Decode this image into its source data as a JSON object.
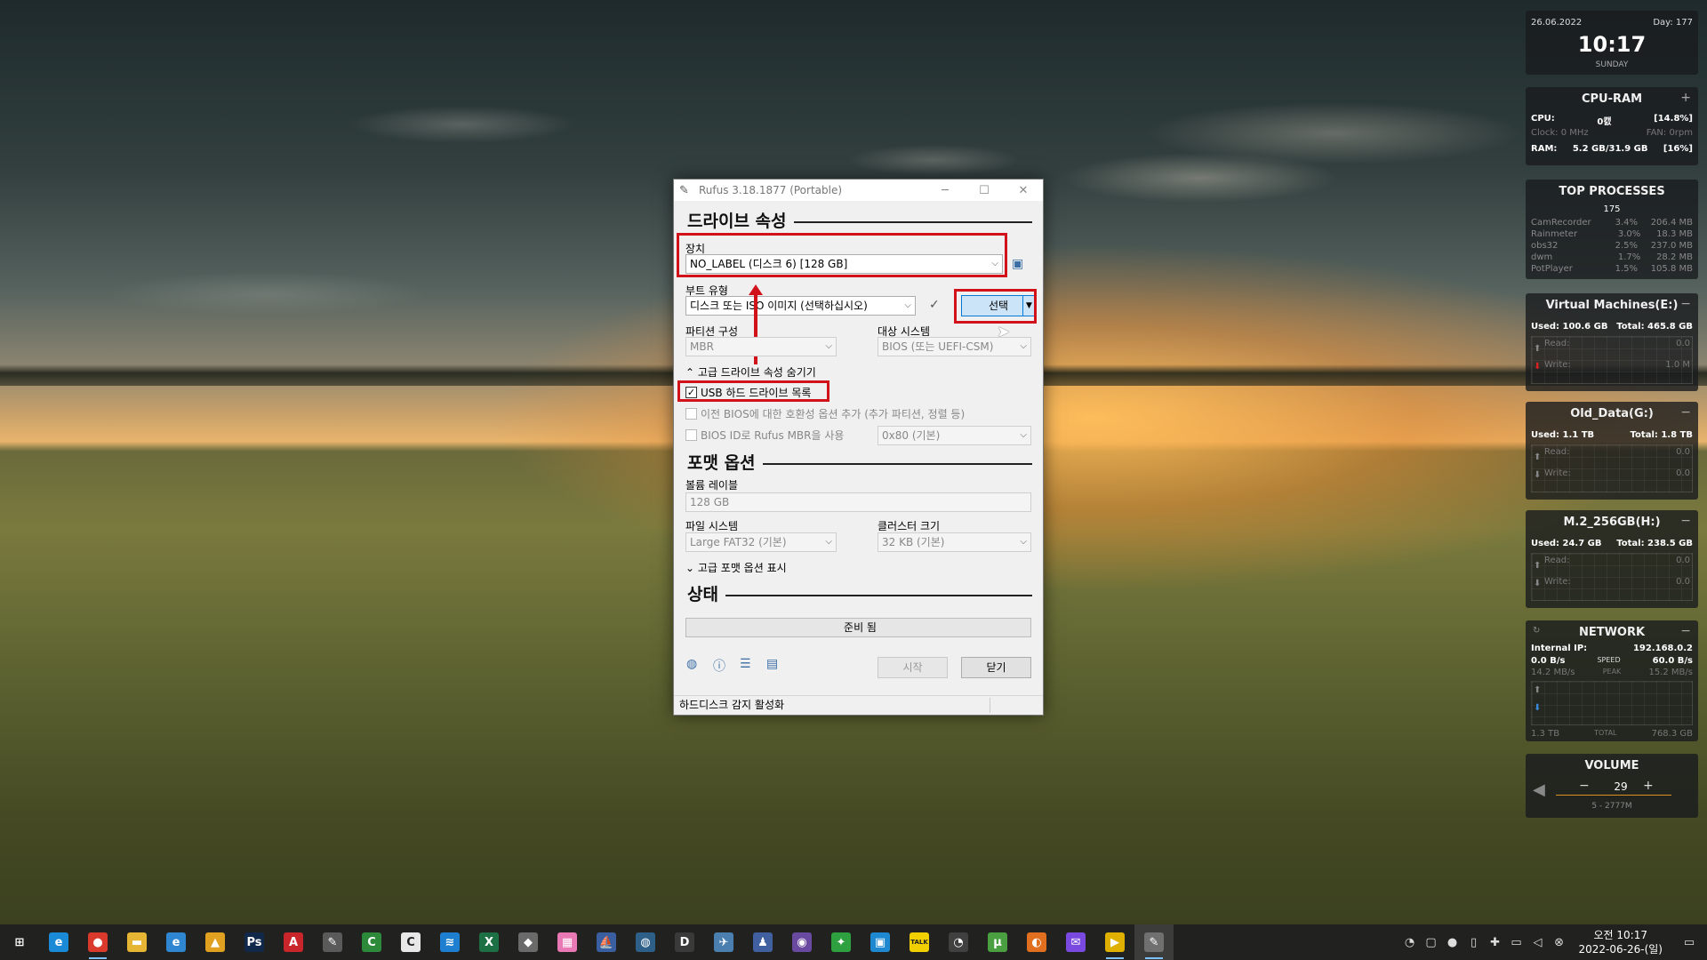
{
  "window": {
    "title": "Rufus 3.18.1877 (Portable)",
    "minimize": "─",
    "maximize": "☐",
    "close": "✕"
  },
  "drive_props": {
    "heading": "드라이브 속성",
    "device_label": "장치",
    "device_value": "NO_LABEL (디스크 6) [128 GB]",
    "boot_type_label": "부트 유형",
    "boot_type_value": "디스크 또는 ISO 이미지 (선택하십시오)",
    "select_button": "선택",
    "partition_label": "파티션 구성",
    "partition_value": "MBR",
    "target_label": "대상 시스템",
    "target_value": "BIOS (또는 UEFI-CSM)",
    "advanced_toggle": "고급 드라이브 속성 숨기기",
    "usb_hdd_label": "USB 하드 드라이브 목록",
    "legacy_bios_label": "이전 BIOS에 대한 호환성 옵션 추가 (추가 파티션, 정렬 등)",
    "rufus_mbr_label": "BIOS ID로 Rufus MBR을 사용",
    "bios_id_value": "0x80 (기본)"
  },
  "format_opts": {
    "heading": "포맷 옵션",
    "volume_label_label": "볼륨 레이블",
    "volume_label_value": "128 GB",
    "filesystem_label": "파일 시스템",
    "filesystem_value": "Large FAT32 (기본)",
    "cluster_label": "클러스터 크기",
    "cluster_value": "32 KB (기본)",
    "advanced_toggle": "고급 포맷 옵션 표시"
  },
  "status": {
    "heading": "상태",
    "progress_text": "준비 됨",
    "start_button": "시작",
    "close_button": "닫기",
    "statusbar_text": "하드디스크 감지 활성화"
  },
  "gadgets": {
    "clock": {
      "date": "26.06.2022",
      "day": "Day: 177",
      "time": "10:17",
      "weekday": "SUNDAY"
    },
    "cpu": {
      "title": "CPU-RAM",
      "cpu_label": "CPU:",
      "cpu_temp": "0캜",
      "cpu_pct": "[14.8%]",
      "clock_label": "Clock: 0 MHz",
      "fan_label": "FAN: 0rpm",
      "ram_label": "RAM:",
      "ram_value": "5.2 GB/31.9 GB",
      "ram_pct": "[16%]"
    },
    "top": {
      "title": "TOP PROCESSES",
      "count": "175",
      "rows": [
        {
          "name": "CamRecorder",
          "cpu": "3.4%",
          "mem": "206.4 MB"
        },
        {
          "name": "Rainmeter",
          "cpu": "3.0%",
          "mem": "18.3 MB"
        },
        {
          "name": "obs32",
          "cpu": "2.5%",
          "mem": "237.0 MB"
        },
        {
          "name": "dwm",
          "cpu": "1.7%",
          "mem": "28.2 MB"
        },
        {
          "name": "PotPlayer",
          "cpu": "1.5%",
          "mem": "105.8 MB"
        }
      ]
    },
    "drives": [
      {
        "title": "Virtual Machines(E:)",
        "used": "Used: 100.6 GB",
        "total": "Total: 465.8 GB",
        "read": "Read:",
        "write": "Write:",
        "rv": "0.0",
        "wv": "1.0 M"
      },
      {
        "title": "Old_Data(G:)",
        "used": "Used: 1.1 TB",
        "total": "Total: 1.8 TB",
        "read": "Read:",
        "write": "Write:",
        "rv": "0.0",
        "wv": "0.0"
      },
      {
        "title": "M.2_256GB(H:)",
        "used": "Used: 24.7 GB",
        "total": "Total: 238.5 GB",
        "read": "Read:",
        "write": "Write:",
        "rv": "0.0",
        "wv": "0.0"
      }
    ],
    "network": {
      "title": "NETWORK",
      "ip_label": "Internal IP:",
      "ip": "192.168.0.2",
      "up": "0.0 B/s",
      "speed_label": "SPEED",
      "speed": "60.0 B/s",
      "down": "14.2 MB/s",
      "peak_label": "PEAK",
      "peak": "15.2 MB/s",
      "total_left": "1.3 TB",
      "total_label": "TOTAL",
      "total_right": "768.3 GB"
    },
    "volume": {
      "title": "VOLUME",
      "minus": "−",
      "value": "29",
      "plus": "+",
      "sub": "5 - 2777M"
    }
  },
  "taskbar": {
    "clock_time": "오전 10:17",
    "clock_date": "2022-06-26-(일)",
    "apps": [
      {
        "name": "start-icon",
        "glyph": "⊞",
        "bg": "transparent"
      },
      {
        "name": "edge-icon",
        "glyph": "e",
        "bg": "#1b8ad6"
      },
      {
        "name": "chrome-icon",
        "glyph": "●",
        "bg": "#d93a2b"
      },
      {
        "name": "file-explorer-icon",
        "glyph": "▬",
        "bg": "#e6b534"
      },
      {
        "name": "ie-icon",
        "glyph": "e",
        "bg": "#2f86d1"
      },
      {
        "name": "app-triangle-icon",
        "glyph": "▲",
        "bg": "#e0a020"
      },
      {
        "name": "photoshop-icon",
        "glyph": "Ps",
        "bg": "#10284a"
      },
      {
        "name": "acrobat-icon",
        "glyph": "A",
        "bg": "#c9262b"
      },
      {
        "name": "app-tool-icon",
        "glyph": "✎",
        "bg": "#5a5a5a"
      },
      {
        "name": "camtasia-icon",
        "glyph": "C",
        "bg": "#2d8a3a"
      },
      {
        "name": "app-c-icon",
        "glyph": "C",
        "bg": "#e8e8e8"
      },
      {
        "name": "app-blue-icon",
        "glyph": "≋",
        "bg": "#1e7fd0"
      },
      {
        "name": "excel-icon",
        "glyph": "X",
        "bg": "#1d7044"
      },
      {
        "name": "app-diamond-icon",
        "glyph": "◆",
        "bg": "#6a6a6a"
      },
      {
        "name": "app-pink-icon",
        "glyph": "▦",
        "bg": "#e879b4"
      },
      {
        "name": "app-ship-icon",
        "glyph": "⛵",
        "bg": "#3a5fa0"
      },
      {
        "name": "globe-icon",
        "glyph": "◍",
        "bg": "#2e5f88"
      },
      {
        "name": "app-d-icon",
        "glyph": "D",
        "bg": "#3a3a3a"
      },
      {
        "name": "app-fish-icon",
        "glyph": "✈",
        "bg": "#4a7fb0"
      },
      {
        "name": "app-user-icon",
        "glyph": "♟",
        "bg": "#4060a0"
      },
      {
        "name": "app-circle-icon",
        "glyph": "◉",
        "bg": "#6a4aa0"
      },
      {
        "name": "app-green-icon",
        "glyph": "✦",
        "bg": "#2fa040"
      },
      {
        "name": "app-frame-icon",
        "glyph": "▣",
        "bg": "#1e88d0"
      },
      {
        "name": "kakaotalk-icon",
        "glyph": "TALK",
        "bg": "#f0d000"
      },
      {
        "name": "app-gauge-icon",
        "glyph": "◔",
        "bg": "#404040"
      },
      {
        "name": "utorrent-icon",
        "glyph": "μ",
        "bg": "#4aa040"
      },
      {
        "name": "app-doc-icon",
        "glyph": "◐",
        "bg": "#e07020"
      },
      {
        "name": "messenger-icon",
        "glyph": "✉",
        "bg": "#7a4ae0"
      },
      {
        "name": "potplayer-icon",
        "glyph": "▶",
        "bg": "#e0b000"
      },
      {
        "name": "rufus-icon",
        "glyph": "✎",
        "bg": "#707070"
      }
    ]
  }
}
